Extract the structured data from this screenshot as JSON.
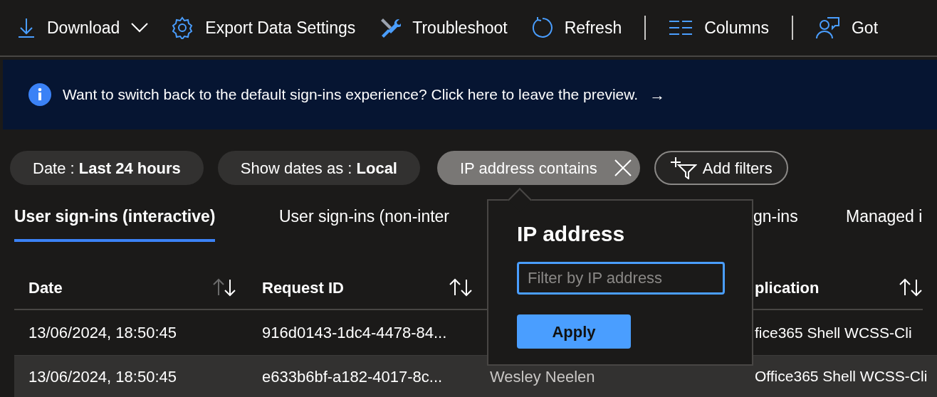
{
  "toolbar": {
    "items": [
      {
        "kind": "dropdown",
        "label": "Download"
      },
      {
        "kind": "button",
        "label": "Export Data Settings"
      },
      {
        "kind": "button",
        "label": "Troubleshoot"
      },
      {
        "kind": "button",
        "label": "Refresh"
      },
      {
        "kind": "separator"
      },
      {
        "kind": "button",
        "label": "Columns"
      },
      {
        "kind": "separator"
      },
      {
        "kind": "button",
        "label": "Got"
      }
    ]
  },
  "banner": {
    "text": "Want to switch back to the default sign-ins experience? Click here to leave the preview.",
    "arrow": "→"
  },
  "filters": [
    {
      "kind": "pill",
      "text": "Date : **Last 24 hours**"
    },
    {
      "kind": "pill",
      "text": "Show dates as : **Local**"
    },
    {
      "kind": "active",
      "text": "IP address contains"
    },
    {
      "kind": "add",
      "text": "Add filters"
    }
  ],
  "tabs": [
    {
      "label": "User sign-ins (interactive)",
      "selected": true
    },
    {
      "label": "User sign-ins (non-inter",
      "selected": false
    },
    {
      "label": "gn-ins",
      "selected": false
    },
    {
      "label": "Managed i",
      "selected": false
    }
  ],
  "table": {
    "columns": [
      {
        "label": "Date"
      },
      {
        "label": "Request ID"
      },
      {
        "label": "plication"
      }
    ],
    "rows": [
      {
        "highlighted": false,
        "cells": [
          "13/06/2024, 18:50:45",
          "916d0143-1dc4-4478-84...",
          "fice365 Shell WCSS-Cli"
        ]
      },
      {
        "highlighted": true,
        "cells": [
          "13/06/2024, 18:50:45",
          "e633b6bf-a182-4017-8c...",
          "Office365 Shell WCSS-Cli"
        ],
        "column_3": "Wesley Neelen"
      }
    ]
  },
  "popup": {
    "title": "IP address",
    "placeholder": "Filter by IP address",
    "button": "Apply"
  }
}
